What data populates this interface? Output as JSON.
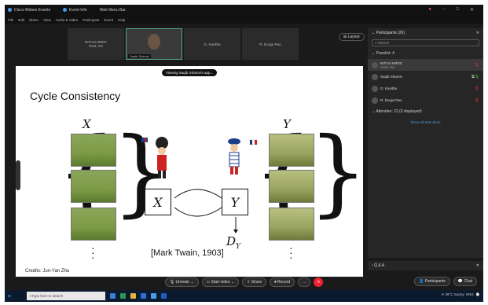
{
  "titlebar": {
    "app": "Cisco Webex Events",
    "info": "Event Info",
    "hide": "Hide Menu Bar"
  },
  "menu": [
    "File",
    "Edit",
    "Share",
    "View",
    "Audio & Video",
    "Participant",
    "Event",
    "Help"
  ],
  "thumbs": [
    {
      "name": "INTUH HRDC",
      "sub": "Host, me"
    },
    {
      "name": "Saqib Shamsi",
      "video": true
    },
    {
      "name": "G. Kavitha"
    },
    {
      "name": "R. Durga Rao"
    }
  ],
  "layout_label": "Layout",
  "viewing": "Viewing Saqib Shamsi's app...",
  "slide": {
    "title": "Cycle Consistency",
    "x_label": "X",
    "y_label": "Y",
    "box_x": "X",
    "box_y": "Y",
    "dy": "D",
    "dy_sub": "Y",
    "citation": "[Mark Twain, 1903]",
    "credits": "Credits: Jun-Yan Zhu"
  },
  "panel": {
    "title": "Participants (26)",
    "search_placeholder": "Search",
    "panelist_header": "Panelist: 4",
    "participants": [
      {
        "name": "INTUH HRDC",
        "sub": "Host, me"
      },
      {
        "name": "Saqib Shamsi"
      },
      {
        "name": "G. Kavitha"
      },
      {
        "name": "R. Durga Rao"
      }
    ],
    "attendee_header": "Attendee: 22 (0 displayed)",
    "show_attendees": "Show all attendees"
  },
  "qa_label": "Q & A",
  "controls": {
    "unmute": "Unmute",
    "video": "Start video",
    "share": "Share",
    "record": "Record",
    "more": "...",
    "end": "✕",
    "participants": "Participants",
    "chat": "Chat"
  },
  "taskbar": {
    "search": "Type here to search",
    "weather": "29°C Sunny",
    "time": "Time",
    "tray_lang": "ENG"
  }
}
